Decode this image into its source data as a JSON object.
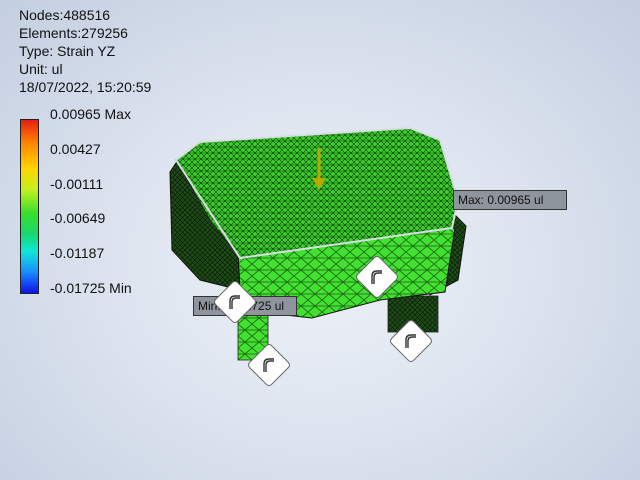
{
  "info": {
    "nodes": "Nodes:488516",
    "elements": "Elements:279256",
    "type": "Type: Strain YZ",
    "unit": "Unit: ul",
    "datetime": "18/07/2022, 15:20:59"
  },
  "legend": {
    "labels": [
      "0.00965 Max",
      "0.00427",
      "-0.00111",
      "-0.00649",
      "-0.01187",
      "-0.01725 Min"
    ]
  },
  "probes": {
    "max": "Max: 0.00965 ul",
    "min": "Min: -0.01725 ul"
  },
  "colors": {
    "mesh_green": "#38d62a",
    "mesh_dark": "#0d3a0a",
    "load_arrow": "#b8a800"
  },
  "icons": [
    "load-arrow-icon",
    "fixed-constraint-icon"
  ]
}
